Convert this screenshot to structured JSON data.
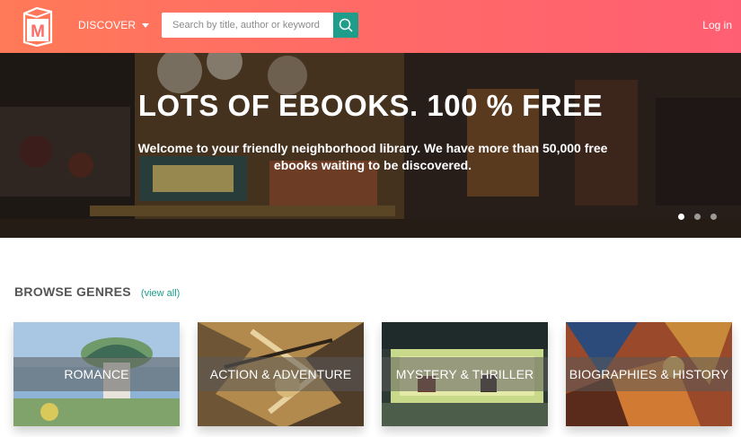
{
  "header": {
    "logo_icon": "book-m-logo-icon",
    "discover_label": "DISCOVER",
    "search": {
      "placeholder": "Search by title, author or keyword",
      "value": ""
    },
    "search_icon": "search-icon",
    "login_label": "Log in",
    "accent_color": "#1e9e8a",
    "bar_color": "#ff6b66"
  },
  "hero": {
    "title": "LOTS OF EBOOKS. 100 % FREE",
    "subtitle": "Welcome to your friendly neighborhood library. We have more than 50,000 free ebooks waiting to be discovered.",
    "slides": 3,
    "active_slide": 1
  },
  "genres": {
    "title": "BROWSE GENRES",
    "view_all": "(view all)",
    "items": [
      {
        "label": "ROMANCE"
      },
      {
        "label": "ACTION & ADVENTURE"
      },
      {
        "label": "MYSTERY & THRILLER"
      },
      {
        "label": "BIOGRAPHIES & HISTORY"
      }
    ]
  }
}
